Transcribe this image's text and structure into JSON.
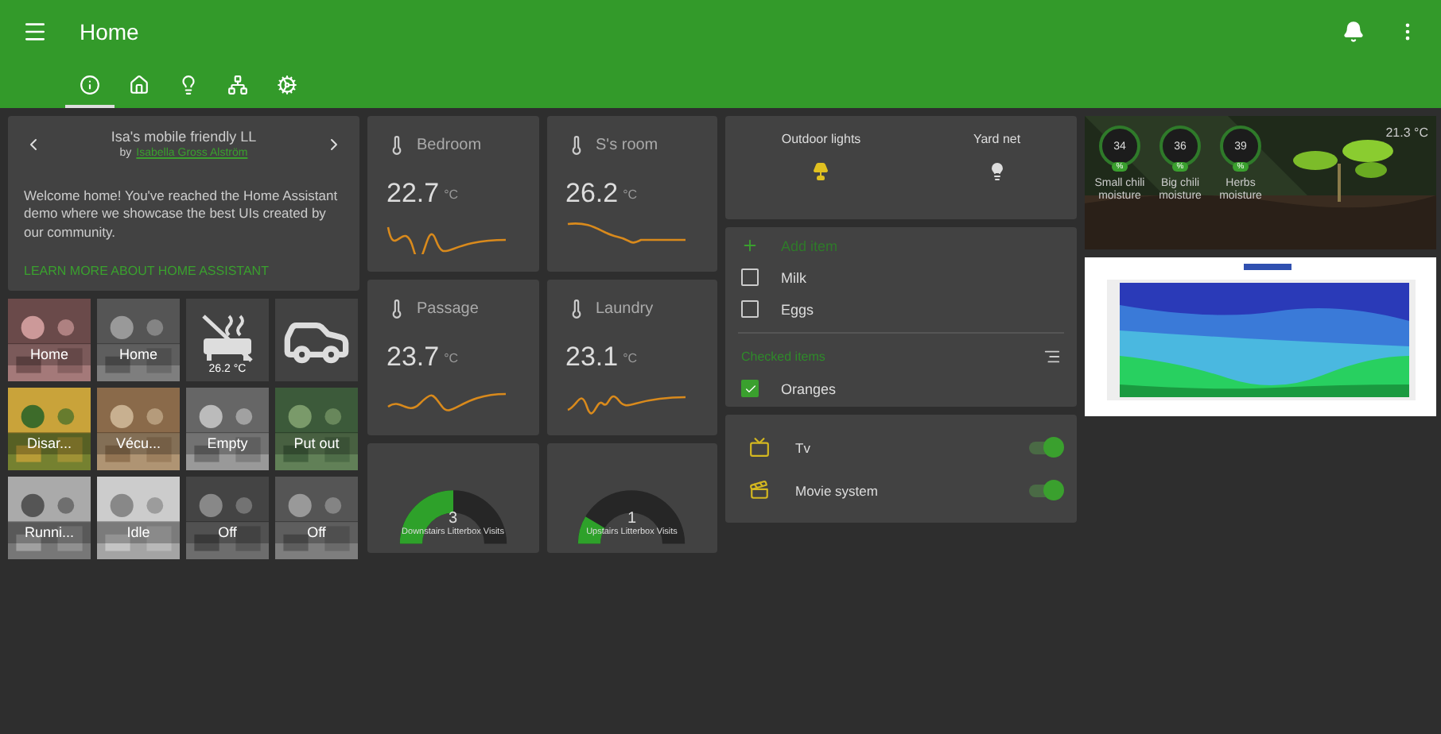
{
  "header": {
    "title": "Home"
  },
  "tabs": [
    {
      "selected": true
    },
    {
      "selected": false
    },
    {
      "selected": false
    },
    {
      "selected": false
    },
    {
      "selected": false
    }
  ],
  "intro": {
    "title": "Isa's mobile friendly LL",
    "by": "by",
    "author": "Isabella Gross Alström",
    "text": "Welcome home! You've reached the Home Assistant demo where we showcase the best UIs created by our community.",
    "link": "LEARN MORE ABOUT HOME ASSISTANT"
  },
  "tiles": [
    {
      "kind": "picture",
      "label": "Home"
    },
    {
      "kind": "picture",
      "label": "Home"
    },
    {
      "kind": "icon",
      "label": "26.2 °C"
    },
    {
      "kind": "icon"
    },
    {
      "kind": "picture",
      "label": "Disar..."
    },
    {
      "kind": "picture",
      "label": "Vécu..."
    },
    {
      "kind": "picture",
      "label": "Empty"
    },
    {
      "kind": "picture",
      "label": "Put out"
    },
    {
      "kind": "picture",
      "label": "Runni..."
    },
    {
      "kind": "picture",
      "label": "Idle"
    },
    {
      "kind": "picture",
      "label": "Off"
    },
    {
      "kind": "picture",
      "label": "Off"
    }
  ],
  "sensors": [
    {
      "name": "Bedroom",
      "value": "22.7",
      "unit": "°C"
    },
    {
      "name": "S's room",
      "value": "26.2",
      "unit": "°C"
    },
    {
      "name": "Passage",
      "value": "23.7",
      "unit": "°C"
    },
    {
      "name": "Laundry",
      "value": "23.1",
      "unit": "°C"
    }
  ],
  "gauges": [
    {
      "value": "3",
      "label": "Downstairs Litterbox Visits",
      "level": 0.5
    },
    {
      "value": "1",
      "label": "Upstairs Litterbox Visits",
      "level": 0.17
    }
  ],
  "lights": [
    {
      "name": "Outdoor lights",
      "on": true
    },
    {
      "name": "Yard net",
      "on": false
    }
  ],
  "shopping": {
    "add": "Add item",
    "items": [
      {
        "name": "Milk",
        "checked": false
      },
      {
        "name": "Eggs",
        "checked": false
      }
    ],
    "checked_title": "Checked items",
    "checked_items": [
      {
        "name": "Oranges",
        "checked": true
      }
    ]
  },
  "switches": [
    {
      "name": "Tv",
      "on": true
    },
    {
      "name": "Movie system",
      "on": true
    }
  ],
  "garden": {
    "temperature": "21.3 °C",
    "plants": [
      {
        "value": "34",
        "unit": "%",
        "name": "Small chili moisture"
      },
      {
        "value": "36",
        "unit": "%",
        "name": "Big chili moisture"
      },
      {
        "value": "39",
        "unit": "%",
        "name": "Herbs moisture"
      }
    ]
  }
}
